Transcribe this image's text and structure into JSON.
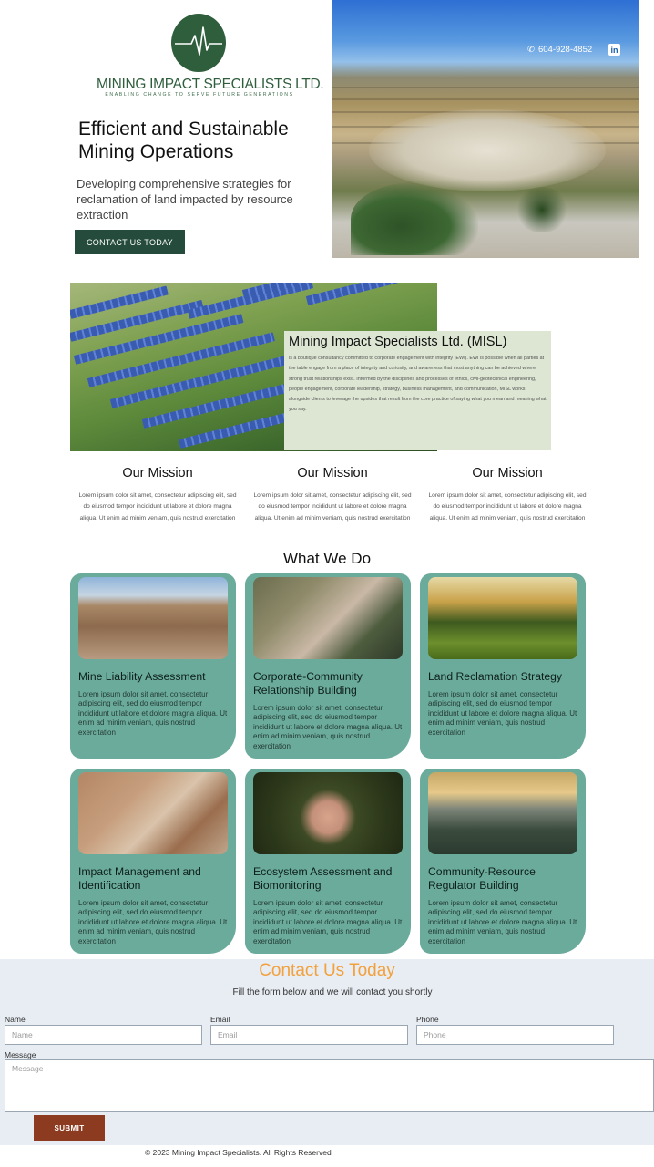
{
  "brand": {
    "name": "MINING IMPACT SPECIALISTS LTD.",
    "tagline": "ENABLING CHANGE TO SERVE FUTURE GENERATIONS",
    "logo_icon": "heartbeat-line-icon",
    "primary_color": "#244b3c",
    "accent_color": "#6bab9b"
  },
  "hero": {
    "title": "Efficient and Sustainable Mining Operations",
    "subtitle": "Developing comprehensive strategies for reclamation of land impacted by resource extraction",
    "cta_label": "CONTACT US TODAY",
    "phone": "604-928-4852",
    "phone_icon": "phone-icon",
    "social_icon": "linkedin-icon",
    "social_icon_text": "in"
  },
  "about": {
    "title": "Mining Impact Specialists Ltd. (MISL)",
    "body": "is a boutique consultancy committed to corporate engagement with integrity (EWI). EWI is possible when all parties at the table engage from a place of integrity and curiosity, and awareness that most anything can be achieved where strong trust relationships exist. Informed by the disciplines and processes of ethics, civil-geotechnical engineering, people engagement, corporate leadership, strategy, business management, and communication, MISL works alongside clients to leverage the upsides that result from the core practice of saying what you mean and meaning what you say."
  },
  "mission": [
    {
      "title": "Our Mission",
      "text": "Lorem ipsum dolor sit amet, consectetur adipiscing elit, sed do eiusmod tempor incididunt ut labore et dolore magna aliqua. Ut enim ad minim veniam, quis nostrud exercitation"
    },
    {
      "title": "Our Mission",
      "text": "Lorem ipsum dolor sit amet, consectetur adipiscing elit, sed do eiusmod tempor incididunt ut labore et dolore magna aliqua. Ut enim ad minim veniam, quis nostrud exercitation"
    },
    {
      "title": "Our Mission",
      "text": "Lorem ipsum dolor sit amet, consectetur adipiscing elit, sed do eiusmod tempor incididunt ut labore et dolore magna aliqua. Ut enim ad minim veniam, quis nostrud exercitation"
    }
  ],
  "services": {
    "title": "What We Do",
    "items": [
      {
        "title": "Mine Liability Assessment",
        "text": "Lorem ipsum dolor sit amet, consectetur adipiscing elit, sed do eiusmod tempor incididunt ut labore et dolore magna aliqua. Ut enim ad minim veniam, quis nostrud exercitation"
      },
      {
        "title": "Corporate-Community Relationship Building",
        "text": "Lorem ipsum dolor sit amet, consectetur adipiscing elit, sed do eiusmod tempor incididunt ut labore et dolore magna aliqua. Ut enim ad minim veniam, quis nostrud exercitation"
      },
      {
        "title": "Land Reclamation Strategy",
        "text": "Lorem ipsum dolor sit amet, consectetur adipiscing elit, sed do eiusmod tempor incididunt ut labore et dolore magna aliqua. Ut enim ad minim veniam, quis nostrud exercitation"
      },
      {
        "title": "Impact Management and Identification",
        "text": "Lorem ipsum dolor sit amet, consectetur adipiscing elit, sed do eiusmod tempor incididunt ut labore et dolore magna aliqua. Ut enim ad minim veniam, quis nostrud exercitation"
      },
      {
        "title": "Ecosystem Assessment and Biomonitoring",
        "text": "Lorem ipsum dolor sit amet, consectetur adipiscing elit, sed do eiusmod tempor incididunt ut labore et dolore magna aliqua. Ut enim ad minim veniam, quis nostrud exercitation"
      },
      {
        "title": "Community-Resource Regulator Building",
        "text": "Lorem ipsum dolor sit amet, consectetur adipiscing elit, sed do eiusmod tempor incididunt ut labore et dolore magna aliqua. Ut enim ad minim veniam, quis nostrud exercitation"
      }
    ]
  },
  "contact": {
    "title": "Contact Us Today",
    "subtitle": "Fill the form below and we will contact you shortly",
    "title_color": "#f2a13d",
    "fields": {
      "name_label": "Name",
      "name_placeholder": "Name",
      "email_label": "Email",
      "email_placeholder": "Email",
      "phone_label": "Phone",
      "phone_placeholder": "Phone",
      "message_label": "Message",
      "message_placeholder": "Message"
    },
    "submit_label": "SUBMIT",
    "submit_color": "#8c3b20"
  },
  "footer": {
    "copyright": "© 2023 Mining Impact Specialists. All Rights Reserved"
  }
}
